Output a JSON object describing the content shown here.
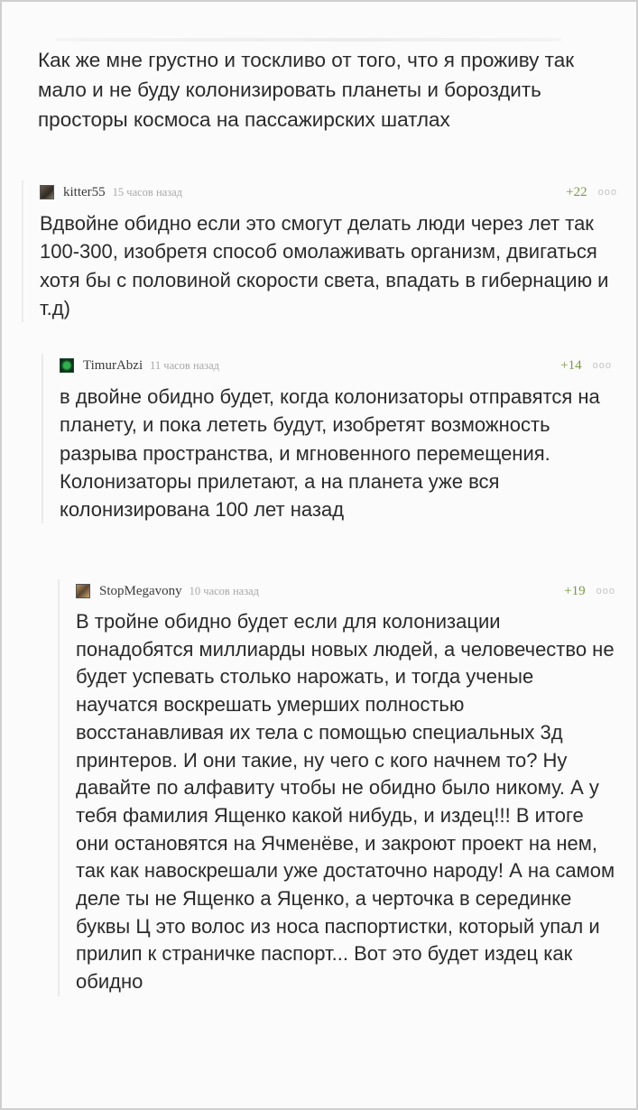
{
  "post": {
    "text": "Как же мне грустно и тоскливо от того, что я проживу так мало и не буду колонизировать планеты и бороздить просторы космоса на пассажирских шатлах"
  },
  "comments": [
    {
      "author": "kitter55",
      "time": "15 часов назад",
      "rating": "+22",
      "more": "ооо",
      "text": "Вдвойне обидно если это смогут делать люди через лет так 100-300, изобретя способ омолаживать организм, двигаться хотя бы с половиной скорости света, впадать в гибернацию и т.д)"
    },
    {
      "author": "TimurAbzi",
      "time": "11 часов назад",
      "rating": "+14",
      "more": "ооо",
      "text": "в двойне обидно будет, когда колонизаторы отправятся на планету, и пока лететь будут, изобретят возможность разрыва пространства, и мгновенного перемещения. Колонизаторы прилетают, а на планета уже вся колонизирована 100 лет назад"
    },
    {
      "author": "StopMegavony",
      "time": "10 часов назад",
      "rating": "+19",
      "more": "ооо",
      "text": "В тройне обидно будет если для колонизации понадобятся миллиарды новых людей, а человечество не будет успевать столько нарожать, и тогда ученые научатся воскрешать умерших полностью восстанавливая их тела с помощью специальных 3д принтеров. И они такие, ну чего с кого начнем то? Ну давайте по алфавиту чтобы не обидно было никому. А у тебя фамилия Ященко какой нибудь, и издец!!! В итоге они остановятся на Ячменёве, и закроют проект на нем, так как навоскрешали уже достаточно народу! А на самом деле ты не Ященко а Яценко, а черточка в серединке буквы Ц это волос из носа паспортистки, который упал и прилип к страничке паспорт... Вот это будет издец как обидно"
    }
  ]
}
